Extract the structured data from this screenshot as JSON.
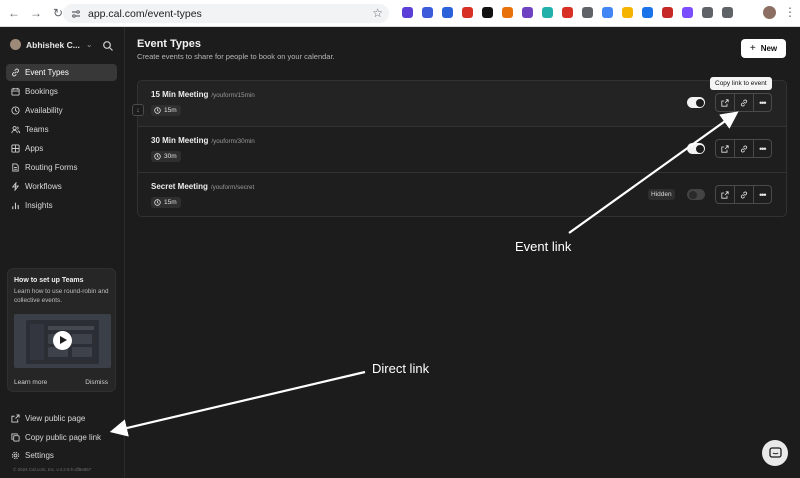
{
  "browser": {
    "url": "app.cal.com/event-types",
    "extension_colors": [
      "#5c3fd6",
      "#3b5bdb",
      "#2b62d9",
      "#d93025",
      "#111111",
      "#e8710a",
      "#6f42c1",
      "#20b2aa",
      "#d93025",
      "#5f6368",
      "#4285f4",
      "#f4b400",
      "#1a73e8",
      "#c62828",
      "#7c4dff",
      "#5f6368",
      "#5f6368"
    ]
  },
  "sidebar": {
    "user_name": "Abhishek C...",
    "items": [
      {
        "label": "Event Types",
        "icon": "link-icon",
        "active": true
      },
      {
        "label": "Bookings",
        "icon": "calendar-icon",
        "active": false
      },
      {
        "label": "Availability",
        "icon": "clock-icon",
        "active": false
      },
      {
        "label": "Teams",
        "icon": "users-icon",
        "active": false
      },
      {
        "label": "Apps",
        "icon": "grid-icon",
        "active": false
      },
      {
        "label": "Routing Forms",
        "icon": "file-icon",
        "active": false
      },
      {
        "label": "Workflows",
        "icon": "zap-icon",
        "active": false
      },
      {
        "label": "Insights",
        "icon": "chart-icon",
        "active": false
      }
    ],
    "promo": {
      "title": "How to set up Teams",
      "description": "Learn how to use round-robin and collective events.",
      "learn_more": "Learn more",
      "dismiss": "Dismiss"
    },
    "bottom_items": [
      {
        "label": "View public page",
        "icon": "external-link-icon"
      },
      {
        "label": "Copy public page link",
        "icon": "copy-icon"
      },
      {
        "label": "Settings",
        "icon": "gear-icon"
      }
    ],
    "footer": "© 2024 Cal.com, Inc. v.4.2.5-h-df8e867"
  },
  "main": {
    "title": "Event Types",
    "subtitle": "Create events to share for people to book on your calendar.",
    "new_button": "New",
    "events": [
      {
        "name": "15 Min Meeting",
        "slug": "/youform/15min",
        "duration": "15m",
        "hidden_label": "",
        "enabled": true
      },
      {
        "name": "30 Min Meeting",
        "slug": "/youform/30min",
        "duration": "30m",
        "hidden_label": "",
        "enabled": true
      },
      {
        "name": "Secret Meeting",
        "slug": "/youform/secret",
        "duration": "15m",
        "hidden_label": "Hidden",
        "enabled": false
      }
    ],
    "tooltip": "Copy link to event"
  },
  "annotations": {
    "event_link": "Event link",
    "direct_link": "Direct link"
  },
  "colors": {
    "background": "#1c1c1c",
    "active_nav": "#383838",
    "accent_white": "#ffffff"
  }
}
